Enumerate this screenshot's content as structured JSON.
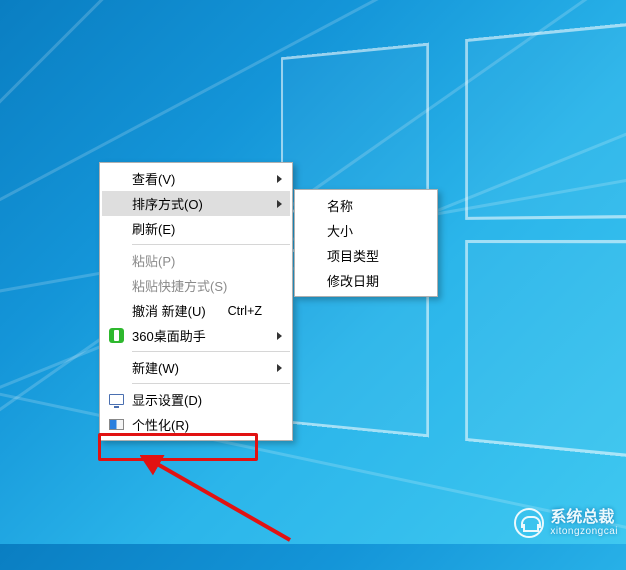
{
  "main_menu": {
    "view": {
      "label": "查看(V)"
    },
    "sort": {
      "label": "排序方式(O)"
    },
    "refresh": {
      "label": "刷新(E)"
    },
    "paste": {
      "label": "粘贴(P)"
    },
    "paste_short": {
      "label": "粘贴快捷方式(S)"
    },
    "undo": {
      "label": "撤消 新建(U)",
      "shortcut": "Ctrl+Z"
    },
    "desk360": {
      "label": "360桌面助手"
    },
    "new": {
      "label": "新建(W)"
    },
    "display": {
      "label": "显示设置(D)"
    },
    "personalize": {
      "label": "个性化(R)"
    }
  },
  "sub_menu": {
    "name": "名称",
    "size": "大小",
    "type": "项目类型",
    "date": "修改日期"
  },
  "watermark": {
    "title": "系统总裁",
    "sub": "xitongzongcai"
  }
}
